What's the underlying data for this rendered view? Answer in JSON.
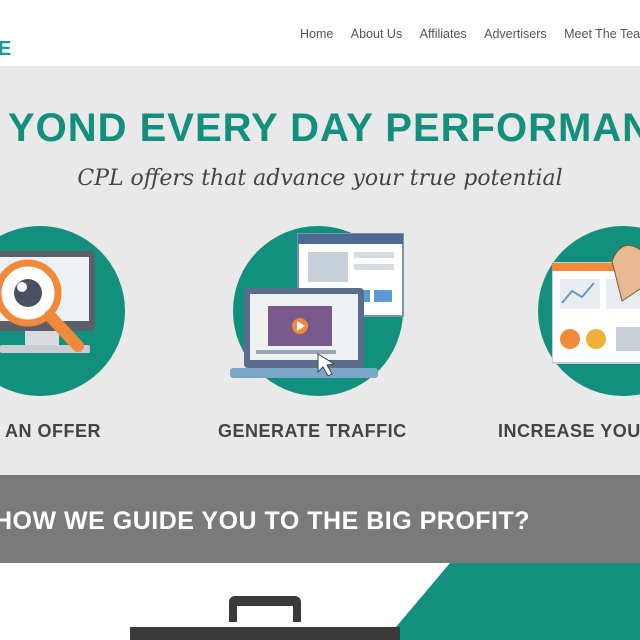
{
  "header": {
    "logo_fragment": "E",
    "nav": [
      "Home",
      "About Us",
      "Affiliates",
      "Advertisers",
      "Meet The Team"
    ]
  },
  "hero": {
    "title": "YOND EVERY DAY PERFORMAN",
    "subtitle": "CPL offers that advance your true potential",
    "steps": [
      {
        "label": "AN OFFER",
        "icon": "magnifier-monitor-icon"
      },
      {
        "label": "GENERATE TRAFFIC",
        "icon": "laptop-video-icon"
      },
      {
        "label": "INCREASE YOU",
        "icon": "dashboard-hand-icon"
      }
    ]
  },
  "band": {
    "text": "HOW WE GUIDE YOU TO THE BIG PROFIT?"
  },
  "colors": {
    "accent": "#128f7d",
    "band": "#7a7a7a",
    "orange": "#f08a3a"
  }
}
